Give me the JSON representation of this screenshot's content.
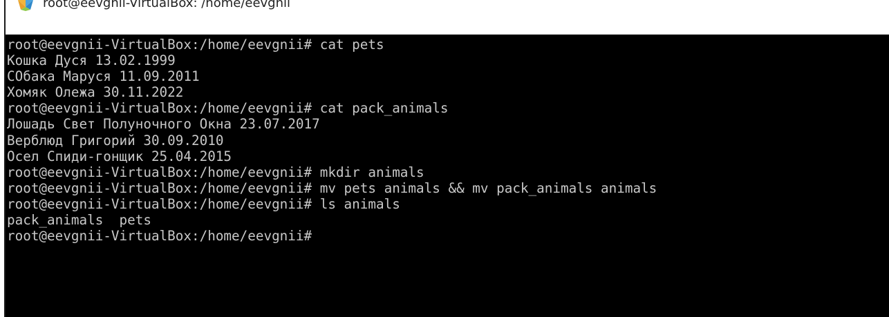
{
  "window": {
    "title": "root@eevgnii-VirtualBox: /home/eevgnii",
    "icon": "putty-terminal-icon"
  },
  "terminal": {
    "lines": [
      "root@eevgnii-VirtualBox:/home/eevgnii# cat pets",
      "Кошка Дуся 13.02.1999",
      "СОбака Маруся 11.09.2011",
      "Хомяк Олежа 30.11.2022",
      "root@eevgnii-VirtualBox:/home/eevgnii# cat pack_animals",
      "Лошадь Свет Полуночного Окна 23.07.2017",
      "Верблюд Григорий 30.09.2010",
      "Осел Спиди-гонщик 25.04.2015",
      "root@eevgnii-VirtualBox:/home/eevgnii# mkdir animals",
      "root@eevgnii-VirtualBox:/home/eevgnii# mv pets animals && mv pack_animals animals",
      "root@eevgnii-VirtualBox:/home/eevgnii# ls animals",
      "pack_animals  pets",
      "root@eevgnii-VirtualBox:/home/eevgnii#"
    ]
  },
  "colors": {
    "terminal_bg": "#000000",
    "terminal_fg": "#c8c8c8"
  }
}
